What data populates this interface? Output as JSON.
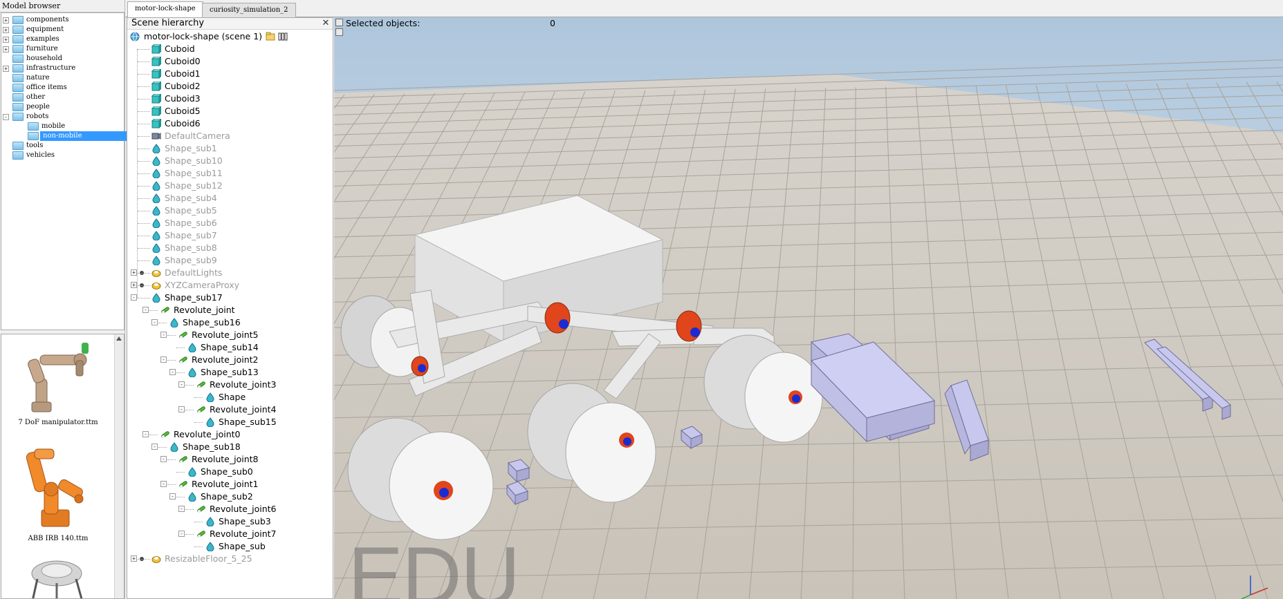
{
  "model_browser": {
    "title": "Model browser",
    "folders": [
      {
        "label": "components",
        "expandable": true,
        "selected": false
      },
      {
        "label": "equipment",
        "expandable": true,
        "selected": false
      },
      {
        "label": "examples",
        "expandable": true,
        "selected": false
      },
      {
        "label": "furniture",
        "expandable": true,
        "selected": false
      },
      {
        "label": "household",
        "expandable": false,
        "selected": false
      },
      {
        "label": "infrastructure",
        "expandable": true,
        "selected": false
      },
      {
        "label": "nature",
        "expandable": false,
        "selected": false
      },
      {
        "label": "office items",
        "expandable": false,
        "selected": false
      },
      {
        "label": "other",
        "expandable": false,
        "selected": false
      },
      {
        "label": "people",
        "expandable": false,
        "selected": false
      },
      {
        "label": "robots",
        "expandable": true,
        "selected": false,
        "expanded": true
      },
      {
        "label": "mobile",
        "expandable": false,
        "selected": false,
        "child": true
      },
      {
        "label": "non-mobile",
        "expandable": false,
        "selected": true,
        "child": true
      },
      {
        "label": "tools",
        "expandable": false,
        "selected": false
      },
      {
        "label": "vehicles",
        "expandable": false,
        "selected": false
      }
    ],
    "models": [
      {
        "caption": "7 DoF manipulator.ttm",
        "icon": "manipulator-thumbnail",
        "color": "#c8a88c"
      },
      {
        "caption": "ABB IRB 140.ttm",
        "icon": "abb-robot-thumbnail",
        "color": "#f08a2a"
      },
      {
        "caption": "",
        "icon": "robot-arm-thumbnail",
        "color": "#cfcfcf"
      }
    ]
  },
  "tabs": [
    {
      "label": "motor-lock-shape",
      "active": true
    },
    {
      "label": "curiosity_simulation_2",
      "active": false
    }
  ],
  "scene_hierarchy": {
    "title": "Scene hierarchy",
    "close_glyph": "✕",
    "scene_label": "motor-lock-shape (scene 1)",
    "items": [
      {
        "label": "Cuboid",
        "depth": 0,
        "icon": "shape",
        "dim": false,
        "expander": ""
      },
      {
        "label": "Cuboid0",
        "depth": 0,
        "icon": "shape",
        "dim": false,
        "expander": ""
      },
      {
        "label": "Cuboid1",
        "depth": 0,
        "icon": "shape",
        "dim": false,
        "expander": ""
      },
      {
        "label": "Cuboid2",
        "depth": 0,
        "icon": "shape",
        "dim": false,
        "expander": ""
      },
      {
        "label": "Cuboid3",
        "depth": 0,
        "icon": "shape",
        "dim": false,
        "expander": ""
      },
      {
        "label": "Cuboid5",
        "depth": 0,
        "icon": "shape",
        "dim": false,
        "expander": ""
      },
      {
        "label": "Cuboid6",
        "depth": 0,
        "icon": "shape",
        "dim": false,
        "expander": ""
      },
      {
        "label": "DefaultCamera",
        "depth": 0,
        "icon": "camera",
        "dim": true,
        "expander": ""
      },
      {
        "label": "Shape_sub1",
        "depth": 0,
        "icon": "drop",
        "dim": true,
        "expander": ""
      },
      {
        "label": "Shape_sub10",
        "depth": 0,
        "icon": "drop",
        "dim": true,
        "expander": ""
      },
      {
        "label": "Shape_sub11",
        "depth": 0,
        "icon": "drop",
        "dim": true,
        "expander": ""
      },
      {
        "label": "Shape_sub12",
        "depth": 0,
        "icon": "drop",
        "dim": true,
        "expander": ""
      },
      {
        "label": "Shape_sub4",
        "depth": 0,
        "icon": "drop",
        "dim": true,
        "expander": ""
      },
      {
        "label": "Shape_sub5",
        "depth": 0,
        "icon": "drop",
        "dim": true,
        "expander": ""
      },
      {
        "label": "Shape_sub6",
        "depth": 0,
        "icon": "drop",
        "dim": true,
        "expander": ""
      },
      {
        "label": "Shape_sub7",
        "depth": 0,
        "icon": "drop",
        "dim": true,
        "expander": ""
      },
      {
        "label": "Shape_sub8",
        "depth": 0,
        "icon": "drop",
        "dim": true,
        "expander": ""
      },
      {
        "label": "Shape_sub9",
        "depth": 0,
        "icon": "drop",
        "dim": true,
        "expander": ""
      },
      {
        "label": "DefaultLights",
        "depth": 0,
        "icon": "dummy",
        "dim": true,
        "expander": "+"
      },
      {
        "label": "XYZCameraProxy",
        "depth": 0,
        "icon": "dummy",
        "dim": true,
        "expander": "+"
      },
      {
        "label": "Shape_sub17",
        "depth": 0,
        "icon": "drop",
        "dim": false,
        "expander": "-"
      },
      {
        "label": "Revolute_joint",
        "depth": 1,
        "icon": "joint",
        "dim": false,
        "expander": "-"
      },
      {
        "label": "Shape_sub16",
        "depth": 2,
        "icon": "drop",
        "dim": false,
        "expander": "-"
      },
      {
        "label": "Revolute_joint5",
        "depth": 3,
        "icon": "joint",
        "dim": false,
        "expander": "-"
      },
      {
        "label": "Shape_sub14",
        "depth": 4,
        "icon": "drop",
        "dim": false,
        "expander": ""
      },
      {
        "label": "Revolute_joint2",
        "depth": 3,
        "icon": "joint",
        "dim": false,
        "expander": "-"
      },
      {
        "label": "Shape_sub13",
        "depth": 4,
        "icon": "drop",
        "dim": false,
        "expander": "-"
      },
      {
        "label": "Revolute_joint3",
        "depth": 5,
        "icon": "joint",
        "dim": false,
        "expander": "-"
      },
      {
        "label": "Shape",
        "depth": 6,
        "icon": "drop",
        "dim": false,
        "expander": ""
      },
      {
        "label": "Revolute_joint4",
        "depth": 5,
        "icon": "joint",
        "dim": false,
        "expander": "-"
      },
      {
        "label": "Shape_sub15",
        "depth": 6,
        "icon": "drop",
        "dim": false,
        "expander": ""
      },
      {
        "label": "Revolute_joint0",
        "depth": 1,
        "icon": "joint",
        "dim": false,
        "expander": "-"
      },
      {
        "label": "Shape_sub18",
        "depth": 2,
        "icon": "drop",
        "dim": false,
        "expander": "-"
      },
      {
        "label": "Revolute_joint8",
        "depth": 3,
        "icon": "joint",
        "dim": false,
        "expander": "-"
      },
      {
        "label": "Shape_sub0",
        "depth": 4,
        "icon": "drop",
        "dim": false,
        "expander": ""
      },
      {
        "label": "Revolute_joint1",
        "depth": 3,
        "icon": "joint",
        "dim": false,
        "expander": "-"
      },
      {
        "label": "Shape_sub2",
        "depth": 4,
        "icon": "drop",
        "dim": false,
        "expander": "-"
      },
      {
        "label": "Revolute_joint6",
        "depth": 5,
        "icon": "joint",
        "dim": false,
        "expander": "-"
      },
      {
        "label": "Shape_sub3",
        "depth": 6,
        "icon": "drop",
        "dim": false,
        "expander": ""
      },
      {
        "label": "Revolute_joint7",
        "depth": 5,
        "icon": "joint",
        "dim": false,
        "expander": "-"
      },
      {
        "label": "Shape_sub",
        "depth": 6,
        "icon": "drop",
        "dim": false,
        "expander": ""
      },
      {
        "label": "ResizableFloor_5_25",
        "depth": 0,
        "icon": "dummy",
        "dim": true,
        "expander": "+"
      }
    ]
  },
  "viewport": {
    "selected_label": "Selected objects:",
    "selected_count": "0",
    "watermark": "EDU",
    "colors": {
      "sky_top": "#aec6dc",
      "sky_bottom": "#e2ebf4",
      "floor": "#cfcac2",
      "chassis": "#e6e6e6",
      "motor": "#e0451c",
      "axle": "#1c2bd1",
      "prop": "#c8c8ee"
    }
  }
}
